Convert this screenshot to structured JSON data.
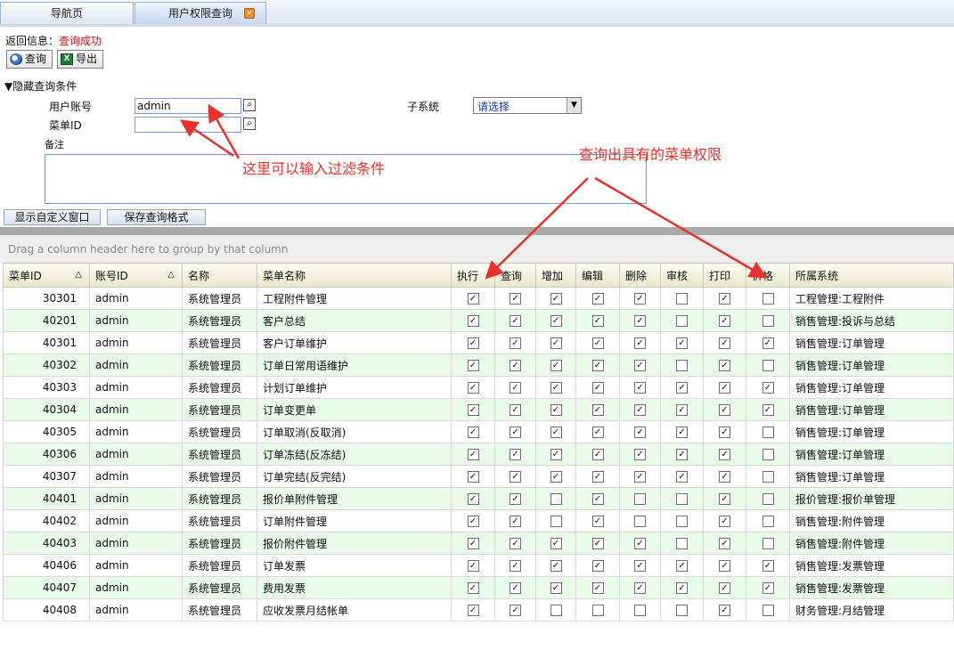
{
  "tabs": [
    {
      "label": "导航页"
    },
    {
      "label": "用户权限查询",
      "close": "×"
    }
  ],
  "return_info": {
    "label": "返回信息：",
    "value": "查询成功"
  },
  "toolbar": {
    "query_label": "查询",
    "export_label": "导出"
  },
  "filter": {
    "toggle_label": "▼隐藏查询条件",
    "user_account_label": "用户账号",
    "user_account_value": "admin",
    "menu_id_label": "菜单ID",
    "menu_id_value": "",
    "subsystem_label": "子系统",
    "subsystem_value": "请选择",
    "remark_label": "备注"
  },
  "buttons": {
    "show_custom": "显示自定义窗口",
    "save_format": "保存查询格式"
  },
  "annotations": {
    "filter_hint": "这里可以输入过滤条件",
    "result_hint": "查询出具有的菜单权限"
  },
  "group_panel": "Drag a column header here to group by that column",
  "grid": {
    "columns": [
      "菜单ID",
      "账号ID",
      "名称",
      "菜单名称",
      "执行",
      "查询",
      "增加",
      "编辑",
      "删除",
      "审核",
      "打印",
      "价格",
      "所属系统"
    ],
    "rows": [
      {
        "id": "30301",
        "account": "admin",
        "name": "系统管理员",
        "menu": "工程附件管理",
        "flags": [
          1,
          1,
          1,
          1,
          1,
          0,
          1,
          0
        ],
        "system": "工程管理:工程附件"
      },
      {
        "id": "40201",
        "account": "admin",
        "name": "系统管理员",
        "menu": "客户总结",
        "flags": [
          1,
          1,
          1,
          1,
          1,
          0,
          1,
          0
        ],
        "system": "销售管理:投诉与总结"
      },
      {
        "id": "40301",
        "account": "admin",
        "name": "系统管理员",
        "menu": "客户订单维护",
        "flags": [
          1,
          1,
          1,
          1,
          1,
          1,
          1,
          1
        ],
        "system": "销售管理:订单管理"
      },
      {
        "id": "40302",
        "account": "admin",
        "name": "系统管理员",
        "menu": "订单日常用语维护",
        "flags": [
          1,
          1,
          1,
          1,
          1,
          0,
          1,
          0
        ],
        "system": "销售管理:订单管理"
      },
      {
        "id": "40303",
        "account": "admin",
        "name": "系统管理员",
        "menu": "计划订单维护",
        "flags": [
          1,
          1,
          1,
          1,
          1,
          1,
          1,
          1
        ],
        "system": "销售管理:订单管理"
      },
      {
        "id": "40304",
        "account": "admin",
        "name": "系统管理员",
        "menu": "订单变更单",
        "flags": [
          1,
          1,
          1,
          1,
          1,
          1,
          1,
          1
        ],
        "system": "销售管理:订单管理"
      },
      {
        "id": "40305",
        "account": "admin",
        "name": "系统管理员",
        "menu": "订单取消(反取消)",
        "flags": [
          1,
          1,
          1,
          1,
          1,
          1,
          1,
          0
        ],
        "system": "销售管理:订单管理"
      },
      {
        "id": "40306",
        "account": "admin",
        "name": "系统管理员",
        "menu": "订单冻结(反冻结)",
        "flags": [
          1,
          1,
          1,
          1,
          1,
          1,
          1,
          0
        ],
        "system": "销售管理:订单管理"
      },
      {
        "id": "40307",
        "account": "admin",
        "name": "系统管理员",
        "menu": "订单完结(反完结)",
        "flags": [
          1,
          1,
          1,
          1,
          1,
          1,
          1,
          0
        ],
        "system": "销售管理:订单管理"
      },
      {
        "id": "40401",
        "account": "admin",
        "name": "系统管理员",
        "menu": "报价单附件管理",
        "flags": [
          1,
          1,
          0,
          1,
          0,
          0,
          1,
          0
        ],
        "system": "报价管理:报价单管理"
      },
      {
        "id": "40402",
        "account": "admin",
        "name": "系统管理员",
        "menu": "订单附件管理",
        "flags": [
          1,
          1,
          0,
          1,
          0,
          0,
          1,
          0
        ],
        "system": "销售管理:附件管理"
      },
      {
        "id": "40403",
        "account": "admin",
        "name": "系统管理员",
        "menu": "报价附件管理",
        "flags": [
          1,
          1,
          1,
          1,
          1,
          0,
          1,
          0
        ],
        "system": "销售管理:附件管理"
      },
      {
        "id": "40406",
        "account": "admin",
        "name": "系统管理员",
        "menu": "订单发票",
        "flags": [
          1,
          1,
          1,
          1,
          1,
          1,
          1,
          1
        ],
        "system": "销售管理:发票管理"
      },
      {
        "id": "40407",
        "account": "admin",
        "name": "系统管理员",
        "menu": "费用发票",
        "flags": [
          1,
          1,
          1,
          1,
          1,
          1,
          1,
          1
        ],
        "system": "销售管理:发票管理"
      },
      {
        "id": "40408",
        "account": "admin",
        "name": "系统管理员",
        "menu": "应收发票月结帐单",
        "flags": [
          1,
          1,
          0,
          0,
          0,
          0,
          1,
          0
        ],
        "system": "财务管理:月结管理"
      }
    ]
  },
  "colors": {
    "annotation": "#e8322b",
    "row_alt": "#e9fbe9",
    "status": "#d41010"
  }
}
